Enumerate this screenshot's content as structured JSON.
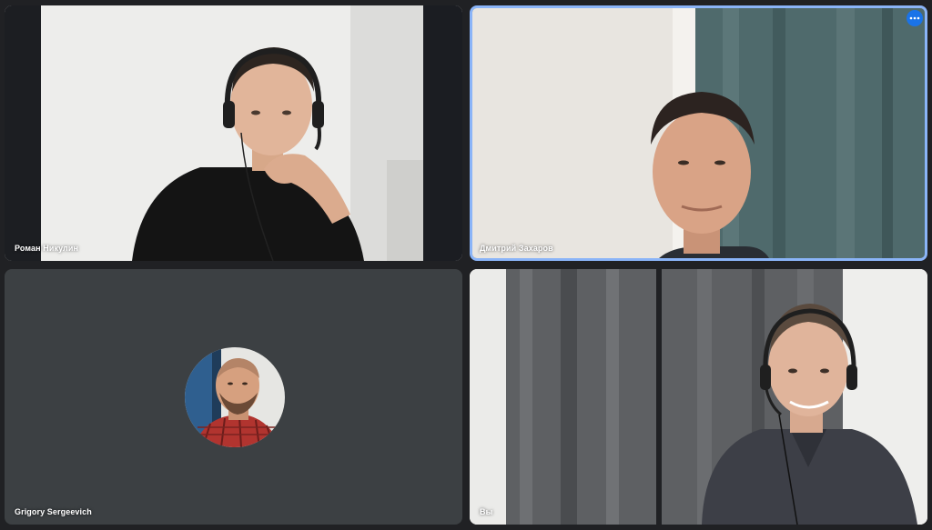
{
  "participants": [
    {
      "name": "Роман Никулин",
      "video_on": true
    },
    {
      "name": "Дмитрий Захаров",
      "video_on": true,
      "active_speaker": true
    },
    {
      "name": "Grigory Sergeevich",
      "video_on": false
    },
    {
      "name": "Вы",
      "video_on": true
    }
  ],
  "controls": {
    "more_options_icon": "more-horiz-icon"
  },
  "colors": {
    "background": "#202124",
    "tile_placeholder": "#3c4043",
    "active_border": "#8ab4f8",
    "accent": "#1a73e8"
  }
}
